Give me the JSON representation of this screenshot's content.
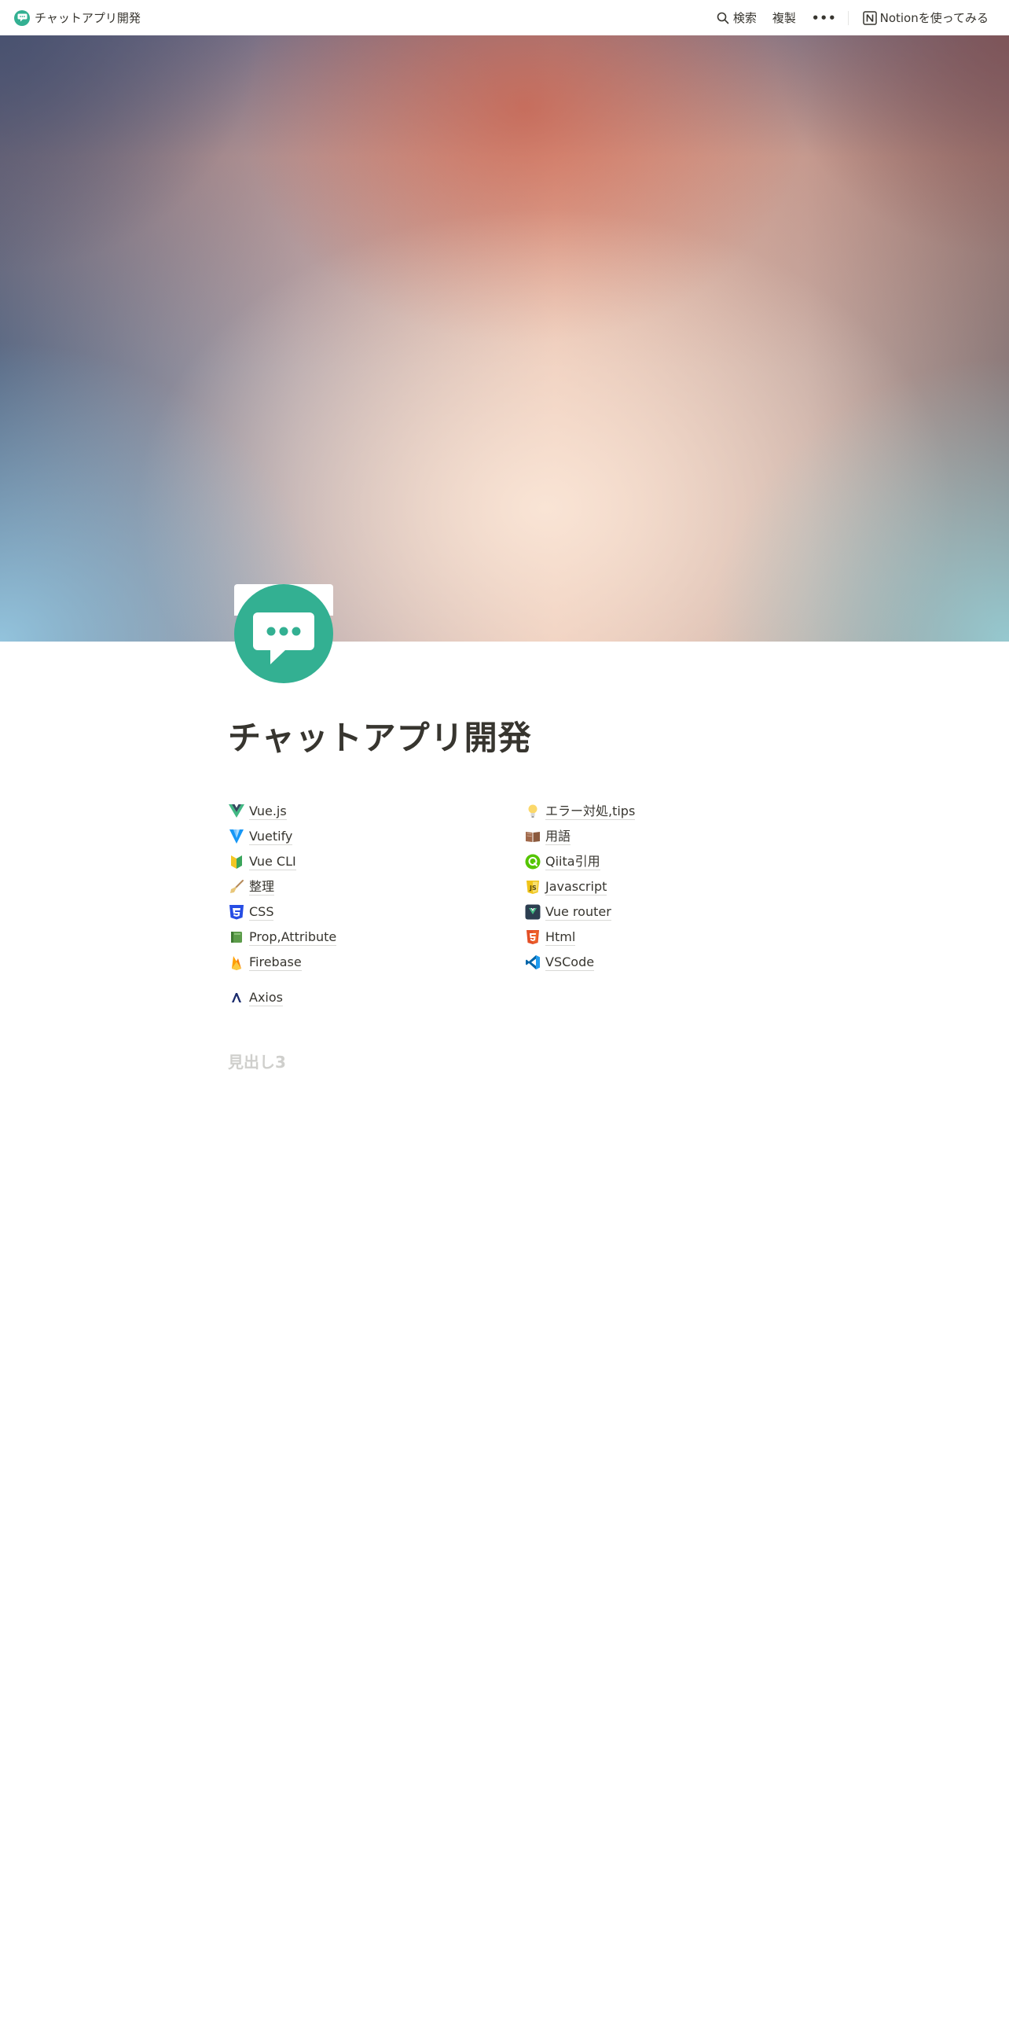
{
  "topbar": {
    "page_title": "チャットアプリ開発",
    "search_label": "検索",
    "duplicate_label": "複製",
    "more_label": "•••",
    "try_notion_label": "Notionを使ってみる"
  },
  "page": {
    "title": "チャットアプリ開発",
    "heading3": "見出し3"
  },
  "links_left": [
    {
      "label": "Vue.js",
      "icon": "vue-icon"
    },
    {
      "label": "Vuetify",
      "icon": "vuetify-icon"
    },
    {
      "label": "Vue CLI",
      "icon": "beginner-icon"
    },
    {
      "label": "整理",
      "icon": "broom-icon"
    },
    {
      "label": "CSS",
      "icon": "css3-icon"
    },
    {
      "label": "Prop,Attribute",
      "icon": "book-icon"
    },
    {
      "label": "Firebase",
      "icon": "firebase-icon"
    }
  ],
  "links_right": [
    {
      "label": "エラー対処,tips",
      "icon": "lightbulb-icon"
    },
    {
      "label": "用語",
      "icon": "open-book-icon"
    },
    {
      "label": "Qiita引用",
      "icon": "qiita-icon"
    },
    {
      "label": "Javascript",
      "icon": "javascript-icon"
    },
    {
      "label": "Vue router",
      "icon": "vue-router-icon"
    },
    {
      "label": "Html",
      "icon": "html5-icon"
    },
    {
      "label": "VSCode",
      "icon": "vscode-icon"
    }
  ],
  "axios": {
    "label": "Axios",
    "icon": "axios-icon"
  },
  "colors": {
    "brand_green": "#33b092",
    "text": "#37352f",
    "muted_heading": "#cfcfcc"
  }
}
